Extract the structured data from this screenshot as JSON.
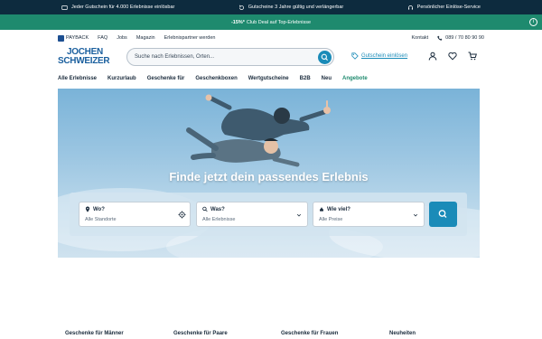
{
  "topbar": {
    "usp1": "Jeder Gutschein für 4.000 Erlebnisse einlösbar",
    "usp2": "Gutscheine 3 Jahre gültig und verlängerbar",
    "usp3": "Persönlicher Einlöse-Service"
  },
  "promo": {
    "highlight": "-15%*",
    "text": "Club Deal auf Top-Erlebnisse"
  },
  "meta": {
    "links": [
      "PAYBACK",
      "FAQ",
      "Jobs",
      "Magazin",
      "Erlebnispartner werden"
    ],
    "contact": "Kontakt",
    "phone": "089 / 70 80 90 90"
  },
  "header": {
    "logo_line1": "JOCHEN",
    "logo_line2": "SCHWEIZER",
    "search_placeholder": "Suche nach Erlebnissen, Orten...",
    "voucher_label": "Gutschein einlösen"
  },
  "nav": [
    "Alle Erlebnisse",
    "Kurzurlaub",
    "Geschenke für",
    "Geschenkboxen",
    "Wertgutscheine",
    "B2B",
    "Neu",
    "Angebote"
  ],
  "hero": {
    "headline": "Finde jetzt dein passendes Erlebnis",
    "where_label": "Wo?",
    "where_value": "Alle Standorte",
    "what_label": "Was?",
    "what_value": "Alle Erlebnisse",
    "price_label": "Wie viel?",
    "price_value": "Alle Preise"
  },
  "categories": [
    "Geschenke für Männer",
    "Geschenke für Paare",
    "Geschenke für Frauen",
    "Neuheiten"
  ],
  "colors": {
    "topbar": "#0d2b3e",
    "promo": "#1e8a6e",
    "accent": "#1a8bb8",
    "brand": "#1a5f9e"
  }
}
